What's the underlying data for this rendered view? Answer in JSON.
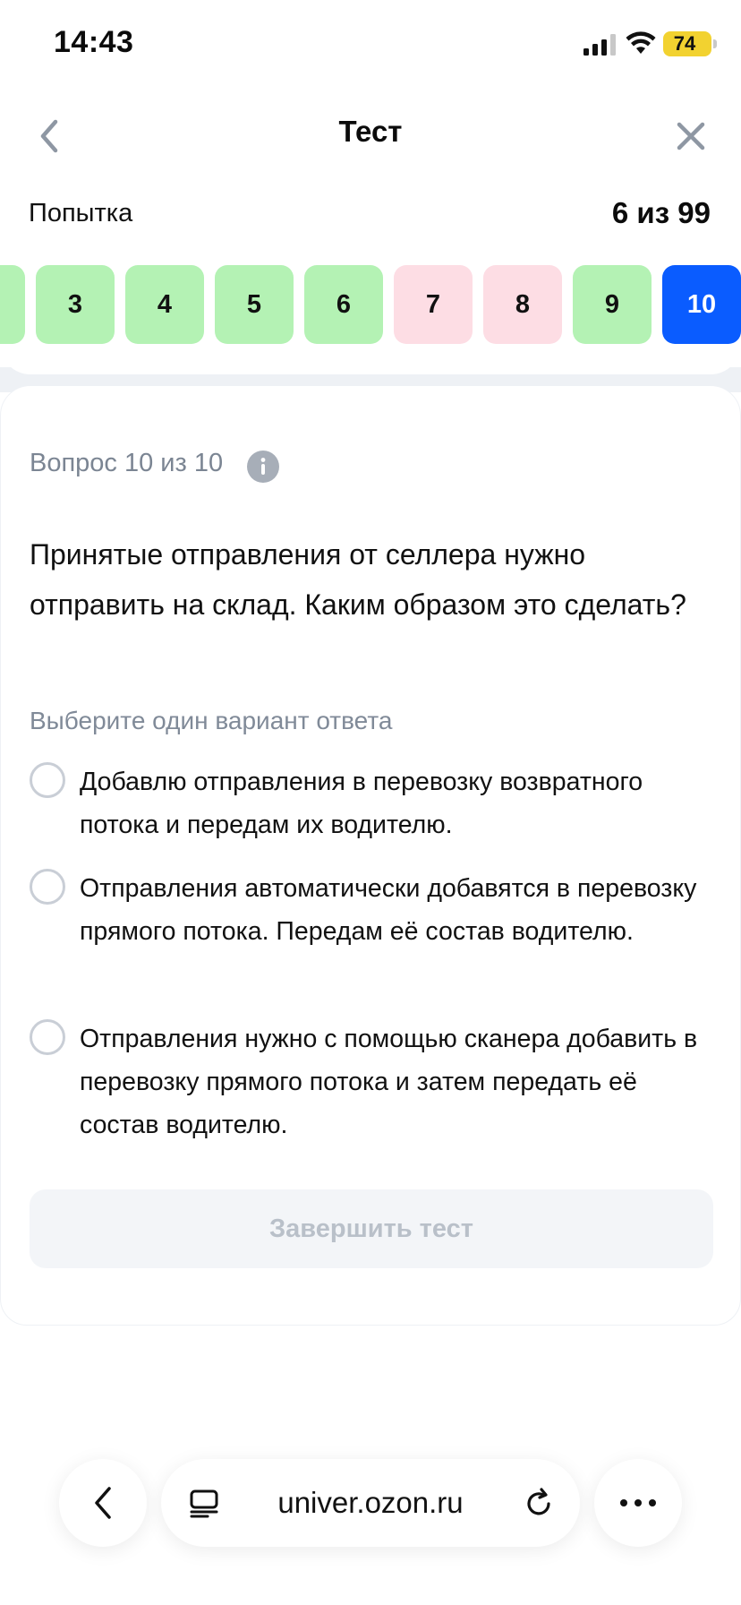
{
  "status_bar": {
    "time": "14:43",
    "battery": "74"
  },
  "header": {
    "title": "Тест",
    "back_icon": "chevron-left-icon",
    "close_icon": "close-icon"
  },
  "attempt": {
    "label": "Попытка",
    "value": "6 из 99"
  },
  "question_strip": [
    {
      "number": "",
      "state": "correct"
    },
    {
      "number": "3",
      "state": "correct"
    },
    {
      "number": "4",
      "state": "correct"
    },
    {
      "number": "5",
      "state": "correct"
    },
    {
      "number": "6",
      "state": "correct"
    },
    {
      "number": "7",
      "state": "incorrect"
    },
    {
      "number": "8",
      "state": "incorrect"
    },
    {
      "number": "9",
      "state": "correct"
    },
    {
      "number": "10",
      "state": "current"
    }
  ],
  "colors": {
    "correct": "#b4f2b4",
    "incorrect": "#fddde4",
    "current": "#0a5cff"
  },
  "question": {
    "counter": "Вопрос 10 из 10",
    "text": "Принятые отправления от селлера нужно отправить на склад. Каким образом это сделать?",
    "hint": "Выберите один вариант ответа",
    "options": [
      "Добавлю отправления в перевозку возвратного потока и передам их водителю.",
      "Отправления автоматически добавятся в перевозку прямого потока. Передам её состав водителю.",
      "Отправления нужно с помощью сканера добавить в перевозку прямого потока и затем передать её состав водителю."
    ]
  },
  "finish_button": "Завершить тест",
  "browser": {
    "url": "univer.ozon.ru"
  }
}
